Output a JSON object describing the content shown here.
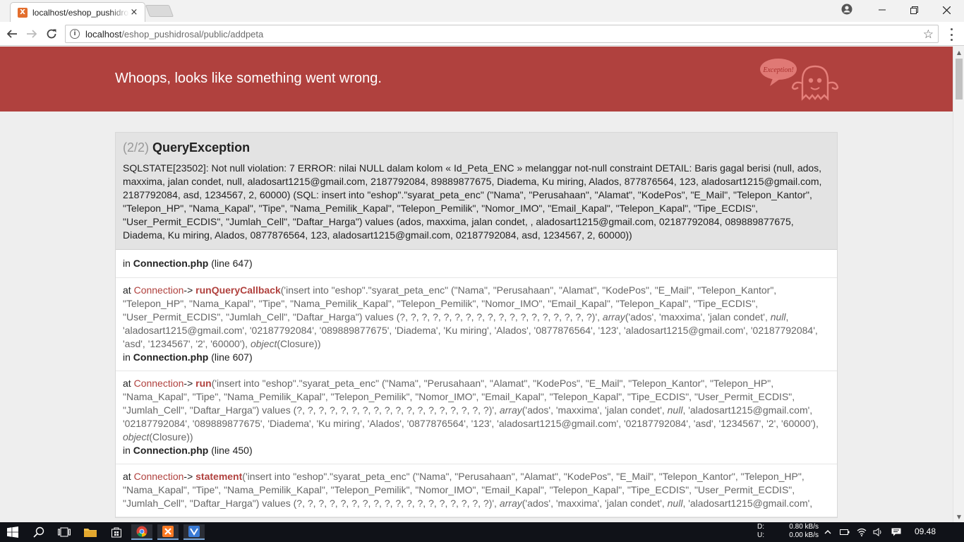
{
  "browser": {
    "tab_title": "localhost/eshop_pushidrosal/public/addpeta",
    "favicon_letter": "X",
    "tab_close": "×",
    "url_host": "localhost",
    "url_path": "/eshop_pushidrosal/public/addpeta"
  },
  "page": {
    "banner_title": "Whoops, looks like something went wrong.",
    "ghost_label": "Exception!",
    "exception": {
      "count": "(2/2)",
      "name": "QueryException",
      "message": "SQLSTATE[23502]: Not null violation: 7 ERROR: nilai NULL dalam kolom « Id_Peta_ENC » melanggar not-null constraint DETAIL: Baris gagal berisi (null, ados, maxxima, jalan condet, null, aladosart1215@gmail.com, 2187792084, 89889877675, Diadema, Ku miring, Alados, 877876564, 123, aladosart1215@gmail.com, 2187792084, asd, 1234567, 2, 60000) (SQL: insert into \"eshop\".\"syarat_peta_enc\" (\"Nama\", \"Perusahaan\", \"Alamat\", \"KodePos\", \"E_Mail\", \"Telepon_Kantor\", \"Telepon_HP\", \"Nama_Kapal\", \"Tipe\", \"Nama_Pemilik_Kapal\", \"Telepon_Pemilik\", \"Nomor_IMO\", \"Email_Kapal\", \"Telepon_Kapal\", \"Tipe_ECDIS\", \"User_Permit_ECDIS\", \"Jumlah_Cell\", \"Daftar_Harga\") values (ados, maxxima, jalan condet, , aladosart1215@gmail.com, 02187792084, 089889877675, Diadema, Ku miring, Alados, 0877876564, 123, aladosart1215@gmail.com, 02187792084, asd, 1234567, 2, 60000))"
    },
    "first_location": {
      "prefix": "in",
      "file": "Connection.php",
      "line": "(line 647)"
    },
    "trace": [
      {
        "at": "at",
        "class": "Connection",
        "arrow": "->",
        "function": "runQueryCallback",
        "args": "('insert into \"eshop\".\"syarat_peta_enc\" (\"Nama\", \"Perusahaan\", \"Alamat\", \"KodePos\", \"E_Mail\", \"Telepon_Kantor\", \"Telepon_HP\", \"Nama_Kapal\", \"Tipe\", \"Nama_Pemilik_Kapal\", \"Telepon_Pemilik\", \"Nomor_IMO\", \"Email_Kapal\", \"Telepon_Kapal\", \"Tipe_ECDIS\", \"User_Permit_ECDIS\", \"Jumlah_Cell\", \"Daftar_Harga\") values (?, ?, ?, ?, ?, ?, ?, ?, ?, ?, ?, ?, ?, ?, ?, ?, ?, ?)', ",
        "array_kw": "array",
        "array_args": "('ados', 'maxxima', 'jalan condet', ",
        "null_kw": "null",
        "array_rest": ", 'aladosart1215@gmail.com', '02187792084', '089889877675', 'Diadema', 'Ku miring', 'Alados', '0877876564', '123', 'aladosart1215@gmail.com', '02187792084', 'asd', '1234567', '2', '60000'), ",
        "object_kw": "object",
        "object_args": "(Closure))",
        "in": "in",
        "file": "Connection.php",
        "line": "(line 607)"
      },
      {
        "at": "at",
        "class": "Connection",
        "arrow": "->",
        "function": "run",
        "args": "('insert into \"eshop\".\"syarat_peta_enc\" (\"Nama\", \"Perusahaan\", \"Alamat\", \"KodePos\", \"E_Mail\", \"Telepon_Kantor\", \"Telepon_HP\", \"Nama_Kapal\", \"Tipe\", \"Nama_Pemilik_Kapal\", \"Telepon_Pemilik\", \"Nomor_IMO\", \"Email_Kapal\", \"Telepon_Kapal\", \"Tipe_ECDIS\", \"User_Permit_ECDIS\", \"Jumlah_Cell\", \"Daftar_Harga\") values (?, ?, ?, ?, ?, ?, ?, ?, ?, ?, ?, ?, ?, ?, ?, ?, ?, ?)', ",
        "array_kw": "array",
        "array_args": "('ados', 'maxxima', 'jalan condet', ",
        "null_kw": "null",
        "array_rest": ", 'aladosart1215@gmail.com', '02187792084', '089889877675', 'Diadema', 'Ku miring', 'Alados', '0877876564', '123', 'aladosart1215@gmail.com', '02187792084', 'asd', '1234567', '2', '60000'), ",
        "object_kw": "object",
        "object_args": "(Closure))",
        "in": "in",
        "file": "Connection.php",
        "line": "(line 450)"
      },
      {
        "at": "at",
        "class": "Connection",
        "arrow": "->",
        "function": "statement",
        "args": "('insert into \"eshop\".\"syarat_peta_enc\" (\"Nama\", \"Perusahaan\", \"Alamat\", \"KodePos\", \"E_Mail\", \"Telepon_Kantor\", \"Telepon_HP\", \"Nama_Kapal\", \"Tipe\", \"Nama_Pemilik_Kapal\", \"Telepon_Pemilik\", \"Nomor_IMO\", \"Email_Kapal\", \"Telepon_Kapal\", \"Tipe_ECDIS\", \"User_Permit_ECDIS\", \"Jumlah_Cell\", \"Daftar_Harga\") values (?, ?, ?, ?, ?, ?, ?, ?, ?, ?, ?, ?, ?, ?, ?, ?, ?, ?)', ",
        "array_kw": "array",
        "array_args": "('ados', 'maxxima', 'jalan condet', ",
        "null_kw": "null",
        "array_rest": ", 'aladosart1215@gmail.com',"
      }
    ]
  },
  "taskbar": {
    "net_down_label": "D:",
    "net_up_label": "U:",
    "net_down_value": "0.80 kB/s",
    "net_up_value": "0.00 kB/s",
    "clock": "09.48"
  },
  "colors": {
    "banner": "#b0413e",
    "accent": "#b0413e"
  },
  "icons": [
    "back-arrow-icon",
    "forward-arrow-icon",
    "reload-icon",
    "info-icon",
    "star-icon",
    "menu-icon",
    "profile-icon",
    "minimize-icon",
    "maximize-icon",
    "close-icon",
    "ghost-icon",
    "windows-start-icon",
    "search-icon",
    "task-view-icon",
    "file-explorer-icon",
    "store-icon",
    "chrome-icon",
    "xampp-icon",
    "app-icon",
    "network-icon",
    "volume-icon",
    "notification-icon"
  ]
}
